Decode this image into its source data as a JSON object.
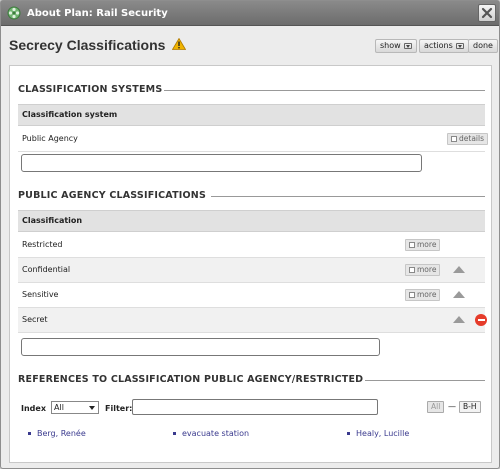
{
  "window": {
    "title": "About Plan: Rail Security",
    "app_icon": "gear-flower-icon",
    "close_icon": "close-icon"
  },
  "header": {
    "heading": "Secrecy Classifications",
    "warning_icon": "warning-icon",
    "show_label": "show",
    "actions_label": "actions",
    "done_label": "done"
  },
  "classification_systems": {
    "section_title": "CLASSIFICATION SYSTEMS",
    "column_header": "Classification system",
    "rows": [
      {
        "label": "Public Agency",
        "button": "details"
      }
    ],
    "new_input_value": ""
  },
  "public_agency": {
    "section_title": "PUBLIC AGENCY CLASSIFICATIONS",
    "column_header": "Classification",
    "rows": [
      {
        "label": "Restricted",
        "button": "more"
      },
      {
        "label": "Confidential",
        "button": "more"
      },
      {
        "label": "Sensitive",
        "button": "more"
      },
      {
        "label": "Secret"
      }
    ],
    "new_input_value": ""
  },
  "references": {
    "section_title": "REFERENCES TO CLASSIFICATION PUBLIC AGENCY/RESTRICTED",
    "index_label": "Index",
    "index_value": "All",
    "filter_label": "Filter:",
    "filter_value": "",
    "all_button": "All",
    "dash": "—",
    "range_button": "B-H",
    "items": [
      "Berg, Renée",
      "evacuate station",
      "Healy, Lucille"
    ]
  },
  "colors": {
    "titlebar": "#7a7a7a",
    "link": "#3a3a8e",
    "remove": "#e53b2a",
    "warning": "#f0b400"
  }
}
